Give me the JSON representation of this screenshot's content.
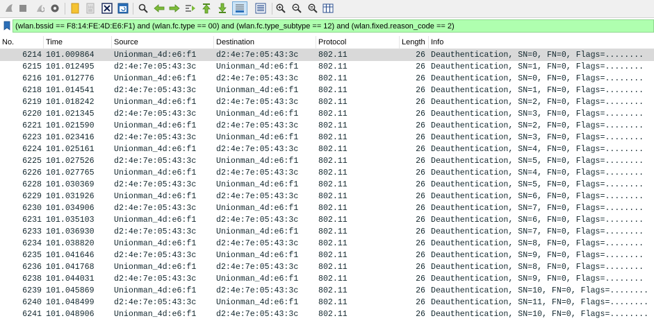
{
  "toolbar": {
    "icons": [
      "shark-fin-start-icon",
      "stop-capture-icon",
      "restart-capture-icon",
      "capture-options-icon",
      "open-file-icon",
      "save-file-icon",
      "close-file-icon",
      "reload-file-icon",
      "find-packet-icon",
      "go-back-icon",
      "go-forward-icon",
      "go-to-packet-icon",
      "go-first-packet-icon",
      "go-last-packet-icon",
      "autoscroll-icon",
      "colorize-icon",
      "zoom-in-icon",
      "zoom-out-icon",
      "normal-size-icon",
      "resize-columns-icon"
    ]
  },
  "filter": {
    "value": "(wlan.bssid == F8:14:FE:4D:E6:F1) and (wlan.fc.type == 00) and (wlan.fc.type_subtype == 12) and (wlan.fixed.reason_code == 2)",
    "valid_color": "#afffaf"
  },
  "columns": {
    "no": "No.",
    "time": "Time",
    "source": "Source",
    "destination": "Destination",
    "protocol": "Protocol",
    "length": "Length",
    "info": "Info"
  },
  "colors": {
    "selected_row": "#d9d9d9",
    "row_text": "#12272e"
  },
  "packets": [
    {
      "no": "6214",
      "time": "101.009864",
      "source": "Unionman_4d:e6:f1",
      "destination": "d2:4e:7e:05:43:3c",
      "protocol": "802.11",
      "length": "26",
      "info": "Deauthentication, SN=0, FN=0, Flags=........",
      "selected": true
    },
    {
      "no": "6215",
      "time": "101.012495",
      "source": "d2:4e:7e:05:43:3c",
      "destination": "Unionman_4d:e6:f1",
      "protocol": "802.11",
      "length": "26",
      "info": "Deauthentication, SN=1, FN=0, Flags=........"
    },
    {
      "no": "6216",
      "time": "101.012776",
      "source": "Unionman_4d:e6:f1",
      "destination": "d2:4e:7e:05:43:3c",
      "protocol": "802.11",
      "length": "26",
      "info": "Deauthentication, SN=0, FN=0, Flags=........"
    },
    {
      "no": "6218",
      "time": "101.014541",
      "source": "d2:4e:7e:05:43:3c",
      "destination": "Unionman_4d:e6:f1",
      "protocol": "802.11",
      "length": "26",
      "info": "Deauthentication, SN=1, FN=0, Flags=........"
    },
    {
      "no": "6219",
      "time": "101.018242",
      "source": "Unionman_4d:e6:f1",
      "destination": "d2:4e:7e:05:43:3c",
      "protocol": "802.11",
      "length": "26",
      "info": "Deauthentication, SN=2, FN=0, Flags=........"
    },
    {
      "no": "6220",
      "time": "101.021345",
      "source": "d2:4e:7e:05:43:3c",
      "destination": "Unionman_4d:e6:f1",
      "protocol": "802.11",
      "length": "26",
      "info": "Deauthentication, SN=3, FN=0, Flags=........"
    },
    {
      "no": "6221",
      "time": "101.021590",
      "source": "Unionman_4d:e6:f1",
      "destination": "d2:4e:7e:05:43:3c",
      "protocol": "802.11",
      "length": "26",
      "info": "Deauthentication, SN=2, FN=0, Flags=........"
    },
    {
      "no": "6223",
      "time": "101.023416",
      "source": "d2:4e:7e:05:43:3c",
      "destination": "Unionman_4d:e6:f1",
      "protocol": "802.11",
      "length": "26",
      "info": "Deauthentication, SN=3, FN=0, Flags=........"
    },
    {
      "no": "6224",
      "time": "101.025161",
      "source": "Unionman_4d:e6:f1",
      "destination": "d2:4e:7e:05:43:3c",
      "protocol": "802.11",
      "length": "26",
      "info": "Deauthentication, SN=4, FN=0, Flags=........"
    },
    {
      "no": "6225",
      "time": "101.027526",
      "source": "d2:4e:7e:05:43:3c",
      "destination": "Unionman_4d:e6:f1",
      "protocol": "802.11",
      "length": "26",
      "info": "Deauthentication, SN=5, FN=0, Flags=........"
    },
    {
      "no": "6226",
      "time": "101.027765",
      "source": "Unionman_4d:e6:f1",
      "destination": "d2:4e:7e:05:43:3c",
      "protocol": "802.11",
      "length": "26",
      "info": "Deauthentication, SN=4, FN=0, Flags=........"
    },
    {
      "no": "6228",
      "time": "101.030369",
      "source": "d2:4e:7e:05:43:3c",
      "destination": "Unionman_4d:e6:f1",
      "protocol": "802.11",
      "length": "26",
      "info": "Deauthentication, SN=5, FN=0, Flags=........"
    },
    {
      "no": "6229",
      "time": "101.031926",
      "source": "Unionman_4d:e6:f1",
      "destination": "d2:4e:7e:05:43:3c",
      "protocol": "802.11",
      "length": "26",
      "info": "Deauthentication, SN=6, FN=0, Flags=........"
    },
    {
      "no": "6230",
      "time": "101.034906",
      "source": "d2:4e:7e:05:43:3c",
      "destination": "Unionman_4d:e6:f1",
      "protocol": "802.11",
      "length": "26",
      "info": "Deauthentication, SN=7, FN=0, Flags=........"
    },
    {
      "no": "6231",
      "time": "101.035103",
      "source": "Unionman_4d:e6:f1",
      "destination": "d2:4e:7e:05:43:3c",
      "protocol": "802.11",
      "length": "26",
      "info": "Deauthentication, SN=6, FN=0, Flags=........"
    },
    {
      "no": "6233",
      "time": "101.036930",
      "source": "d2:4e:7e:05:43:3c",
      "destination": "Unionman_4d:e6:f1",
      "protocol": "802.11",
      "length": "26",
      "info": "Deauthentication, SN=7, FN=0, Flags=........"
    },
    {
      "no": "6234",
      "time": "101.038820",
      "source": "Unionman_4d:e6:f1",
      "destination": "d2:4e:7e:05:43:3c",
      "protocol": "802.11",
      "length": "26",
      "info": "Deauthentication, SN=8, FN=0, Flags=........"
    },
    {
      "no": "6235",
      "time": "101.041646",
      "source": "d2:4e:7e:05:43:3c",
      "destination": "Unionman_4d:e6:f1",
      "protocol": "802.11",
      "length": "26",
      "info": "Deauthentication, SN=9, FN=0, Flags=........"
    },
    {
      "no": "6236",
      "time": "101.041768",
      "source": "Unionman_4d:e6:f1",
      "destination": "d2:4e:7e:05:43:3c",
      "protocol": "802.11",
      "length": "26",
      "info": "Deauthentication, SN=8, FN=0, Flags=........"
    },
    {
      "no": "6238",
      "time": "101.044031",
      "source": "d2:4e:7e:05:43:3c",
      "destination": "Unionman_4d:e6:f1",
      "protocol": "802.11",
      "length": "26",
      "info": "Deauthentication, SN=9, FN=0, Flags=........"
    },
    {
      "no": "6239",
      "time": "101.045869",
      "source": "Unionman_4d:e6:f1",
      "destination": "d2:4e:7e:05:43:3c",
      "protocol": "802.11",
      "length": "26",
      "info": "Deauthentication, SN=10, FN=0, Flags=........"
    },
    {
      "no": "6240",
      "time": "101.048499",
      "source": "d2:4e:7e:05:43:3c",
      "destination": "Unionman_4d:e6:f1",
      "protocol": "802.11",
      "length": "26",
      "info": "Deauthentication, SN=11, FN=0, Flags=........"
    },
    {
      "no": "6241",
      "time": "101.048906",
      "source": "Unionman_4d:e6:f1",
      "destination": "d2:4e:7e:05:43:3c",
      "protocol": "802.11",
      "length": "26",
      "info": "Deauthentication, SN=10, FN=0, Flags=........"
    }
  ]
}
